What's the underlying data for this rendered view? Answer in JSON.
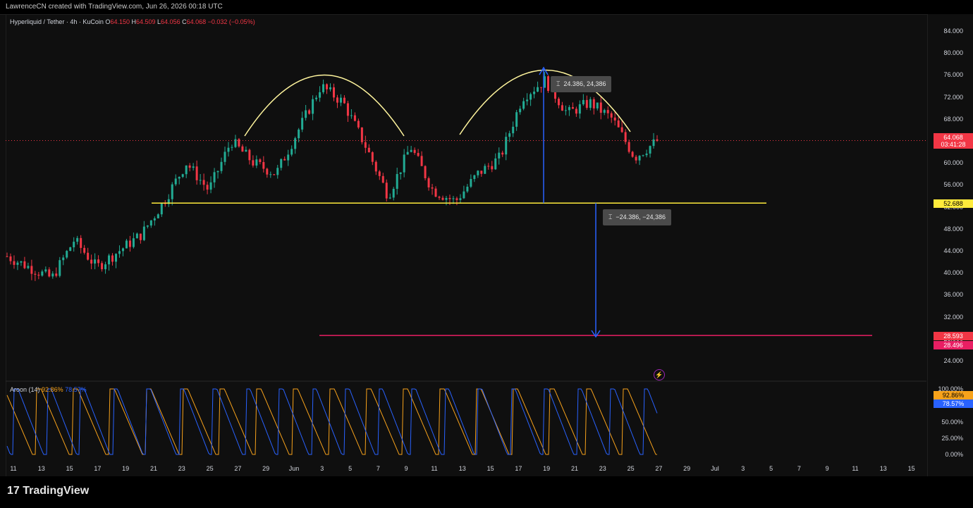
{
  "header": {
    "credit": "LawrenceCN created with TradingView.com, Jun 26, 2026 00:18 UTC"
  },
  "legend": {
    "symbol": "Hyperliquid / Tether · 4h · KuCoin",
    "o_label": "O",
    "o": "64.150",
    "h_label": "H",
    "h": "64.509",
    "l_label": "L",
    "l": "64.056",
    "c_label": "C",
    "c": "64.068",
    "change": "−0.032 (−0.05%)"
  },
  "aroon": {
    "label": "Aroon (14)",
    "up": "92.86%",
    "down": "78.57%"
  },
  "price_axis": {
    "ticks": [
      "84.000",
      "80.000",
      "76.000",
      "72.000",
      "68.000",
      "64.000",
      "60.000",
      "56.000",
      "52.000",
      "48.000",
      "44.000",
      "40.000",
      "36.000",
      "32.000",
      "28.000",
      "24.000"
    ],
    "last_price": "64.068",
    "countdown": "03:41:28",
    "neckline_label": "52.688",
    "target_label_1": "28.593",
    "target_label_2": "28.496"
  },
  "aroon_axis": {
    "ticks": [
      "100.00%",
      "50.00%",
      "25.00%",
      "0.00%"
    ],
    "up_tag": "92.86%",
    "down_tag": "78.57%"
  },
  "time_axis": [
    "11",
    "13",
    "15",
    "17",
    "19",
    "21",
    "23",
    "25",
    "27",
    "29",
    "Jun",
    "3",
    "5",
    "7",
    "9",
    "11",
    "13",
    "15",
    "17",
    "19",
    "21",
    "23",
    "25",
    "27",
    "29",
    "Jul",
    "3",
    "5",
    "7",
    "9",
    "11",
    "13",
    "15"
  ],
  "measures": {
    "up": "24.386, 24,386",
    "down": "−24.386, −24,386"
  },
  "footer": {
    "brand": "TradingView"
  },
  "colors": {
    "up": "#22ab94",
    "down": "#f23645",
    "aroon_up": "#f7a21b",
    "aroon_down": "#2962ff",
    "neckline": "#ffeb3b",
    "target": "#e91e63",
    "arc": "#fff59d"
  },
  "chart_data": {
    "type": "candlestick",
    "timeframe": "4h",
    "ylim": [
      22,
      86
    ],
    "x_dates": [
      "May 11",
      "May 13",
      "May 15",
      "May 17",
      "May 19",
      "May 21",
      "May 23",
      "May 25",
      "May 27",
      "May 29",
      "Jun 1",
      "Jun 3",
      "Jun 5",
      "Jun 7",
      "Jun 9",
      "Jun 11",
      "Jun 13",
      "Jun 15",
      "Jun 17",
      "Jun 19",
      "Jun 21",
      "Jun 23",
      "Jun 25"
    ],
    "approx_close_path": [
      43,
      41,
      39,
      46,
      41,
      44,
      47,
      53,
      60,
      55,
      64,
      60,
      58,
      66,
      74,
      71,
      63,
      54,
      63,
      55,
      53,
      58,
      61,
      72,
      75,
      69,
      71,
      68,
      61,
      64
    ],
    "neckline": 52.688,
    "target": 28.593,
    "measured_move": 24.386,
    "annotations": [
      "double-top arcs",
      "measured move up 24.386",
      "measured move down −24.386"
    ]
  }
}
